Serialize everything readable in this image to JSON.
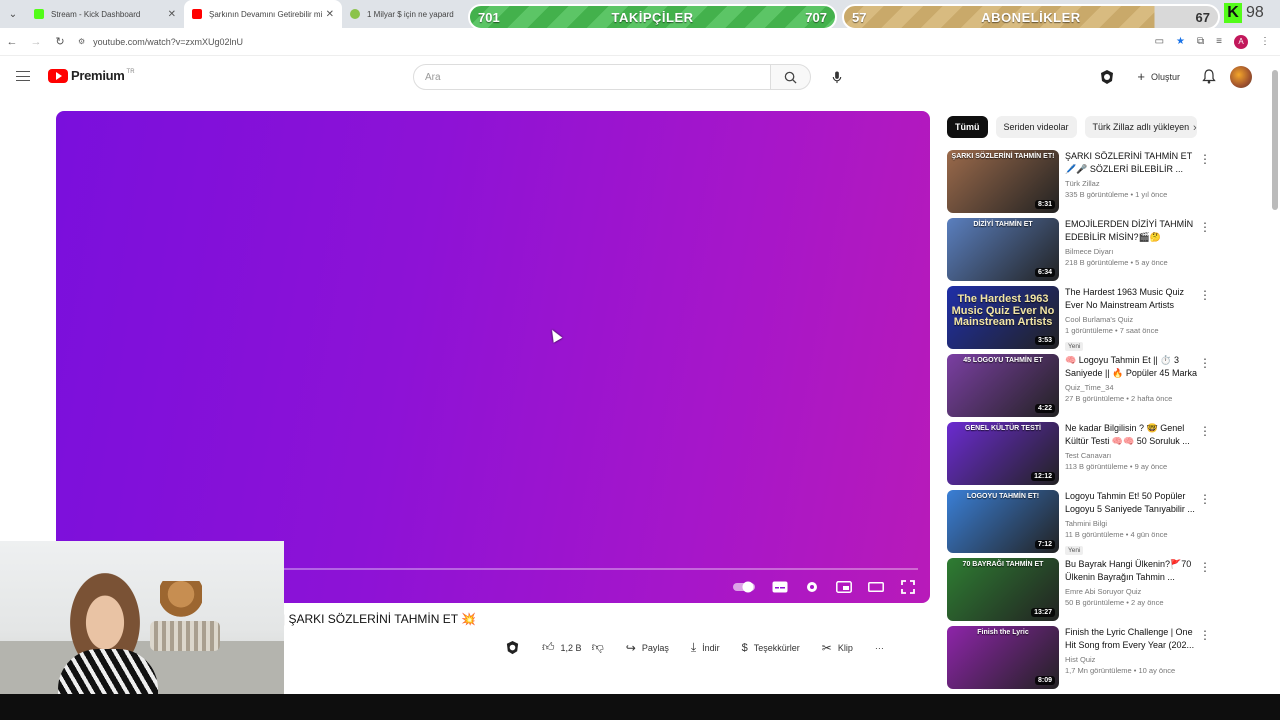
{
  "browser": {
    "tabs": [
      {
        "title": "Stream - Kick Dashboard",
        "favicon_color": "#53fc18",
        "active": false
      },
      {
        "title": "Şarkının Devamını Getirebilir mi?",
        "favicon_color": "#ff0000",
        "active": true
      },
      {
        "title": "1 Milyar $ için ne yapardın?",
        "favicon_color": "#8bc34a",
        "active": false
      }
    ],
    "url": "youtube.com/watch?v=zxmXUg02lnU",
    "profile_initial": "A"
  },
  "overlay": {
    "followers": {
      "label": "TAKİPÇİLER",
      "current": "701",
      "goal": "707"
    },
    "subscribers": {
      "label": "ABONELİKLER",
      "current": "57",
      "goal": "67"
    },
    "kick_viewers": "98"
  },
  "youtube": {
    "brand": "Premium",
    "country": "TR",
    "search_placeholder": "Ara",
    "create_label": "Oluştur"
  },
  "video": {
    "title": "| ŞARKI SÖZLERİNİ TAHMİN ET 💥",
    "like_count": "1,2 B",
    "share_label": "Paylaş",
    "download_label": "İndir",
    "thanks_label": "Teşekkürler",
    "clip_label": "Klip",
    "more_label": "···"
  },
  "chips": [
    "Tümü",
    "Seriden videolar",
    "Türk Zillaz adlı yükleyen"
  ],
  "recommendations": [
    {
      "thumb_text": "ŞARKI SÖZLERİNİ TAHMİN ET!",
      "thumb_bg": "#9b6a4b",
      "duration": "8:31",
      "title": "ŞARKI SÖZLERİNİ TAHMİN ET 🖊️🎤 SÖZLERİ BİLEBİLİR ...",
      "channel": "Türk Zillaz",
      "meta": "335 B görüntüleme • 1 yıl önce",
      "badge": ""
    },
    {
      "thumb_text": "DİZİYİ TAHMİN ET",
      "thumb_bg": "#5a7fbf",
      "duration": "6:34",
      "title": "EMOJİLERDEN DİZİYİ TAHMİN EDEBİLİR MİSİN?🎬🤔",
      "channel": "Bilmece Diyarı",
      "meta": "218 B görüntüleme • 5 ay önce",
      "badge": ""
    },
    {
      "thumb_text": "The Hardest 1963 Music Quiz Ever No Mainstream Artists",
      "thumb_bg": "#1f2fa8",
      "duration": "3:53",
      "title": "The Hardest 1963 Music Quiz Ever No Mainstream Artists",
      "channel": "Cool Burlama's Quiz",
      "meta": "1 görüntüleme • 7 saat önce",
      "badge": "Yeni"
    },
    {
      "thumb_text": "45 LOGOYU TAHMİN ET",
      "thumb_bg": "#7b3fa3",
      "duration": "4:22",
      "title": "🧠 Logoyu Tahmin Et || ⏱️ 3 Saniyede || 🔥 Popüler 45 Marka",
      "channel": "Quiz_Time_34",
      "meta": "27 B görüntüleme • 2 hafta önce",
      "badge": ""
    },
    {
      "thumb_text": "GENEL KÜLTÜR TESTİ",
      "thumb_bg": "#6b2bd1",
      "duration": "12:12",
      "title": "Ne kadar Bilgilisin ? 🤓 Genel Kültür Testi 🧠🧠 50 Soruluk ...",
      "channel": "Test Canavarı",
      "meta": "113 B görüntüleme • 9 ay önce",
      "badge": ""
    },
    {
      "thumb_text": "LOGOYU TAHMİN ET!",
      "thumb_bg": "#3a7fd6",
      "duration": "7:12",
      "title": "Logoyu Tahmin Et! 50 Popüler Logoyu 5 Saniyede Tanıyabilir ...",
      "channel": "Tahmini Bilgi",
      "meta": "11 B görüntüleme • 4 gün önce",
      "badge": "Yeni"
    },
    {
      "thumb_text": "70 BAYRAĞI TAHMİN ET",
      "thumb_bg": "#2e7d32",
      "duration": "13:27",
      "title": "Bu Bayrak Hangi Ülkenin?🚩70 Ülkenin Bayrağın Tahmin ...",
      "channel": "Emre Abi Soruyor Quiz",
      "meta": "50 B görüntüleme • 2 ay önce",
      "badge": ""
    },
    {
      "thumb_text": "Finish the Lyric",
      "thumb_bg": "#8e24aa",
      "duration": "8:09",
      "title": "Finish the Lyric Challenge | One Hit Song from Every Year (202...",
      "channel": "Hist Quiz",
      "meta": "1,7 Mn görüntüleme • 10 ay önce",
      "badge": ""
    }
  ],
  "colors": {
    "player_start": "#7a0fdc",
    "player_end": "#b81ab9",
    "followers_bar": "#43b14c",
    "subscribers_bar": "#c9a96a",
    "youtube_red": "#ff0000",
    "kick_green": "#53fc18"
  }
}
